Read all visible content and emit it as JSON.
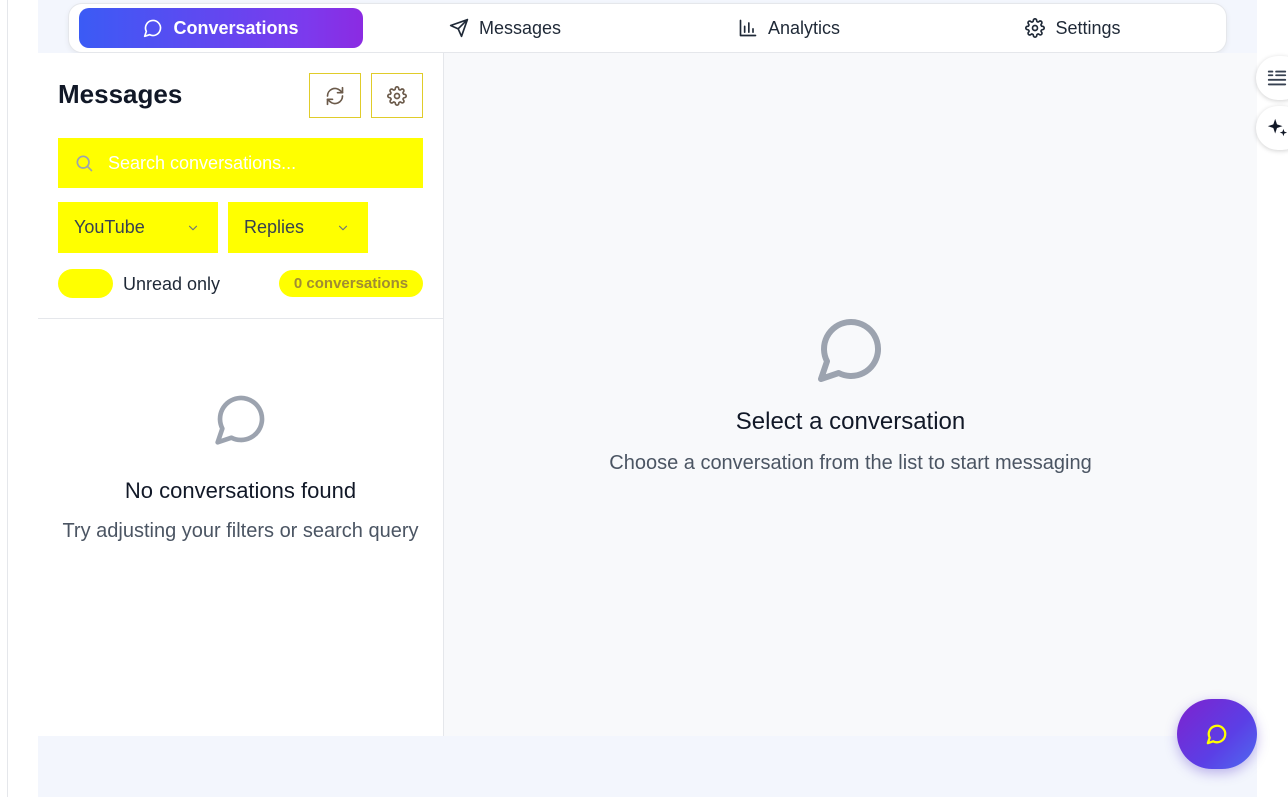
{
  "tabs": [
    {
      "label": "Conversations",
      "icon": "message-circle-icon",
      "active": true
    },
    {
      "label": "Messages",
      "icon": "send-icon",
      "active": false
    },
    {
      "label": "Analytics",
      "icon": "bar-chart-icon",
      "active": false
    },
    {
      "label": "Settings",
      "icon": "gear-icon",
      "active": false
    }
  ],
  "sidebar": {
    "title": "Messages",
    "search_placeholder": "Search conversations...",
    "platform_filter": "YouTube",
    "type_filter": "Replies",
    "unread_label": "Unread only",
    "count_badge": "0 conversations",
    "empty_title": "No conversations found",
    "empty_subtitle": "Try adjusting your filters or search query"
  },
  "main": {
    "empty_title": "Select a conversation",
    "empty_subtitle": "Choose a conversation from the list to start messaging"
  },
  "colors": {
    "accent_start": "#3b5bf5",
    "accent_end": "#8b2be2",
    "highlight": "#ffff00"
  }
}
